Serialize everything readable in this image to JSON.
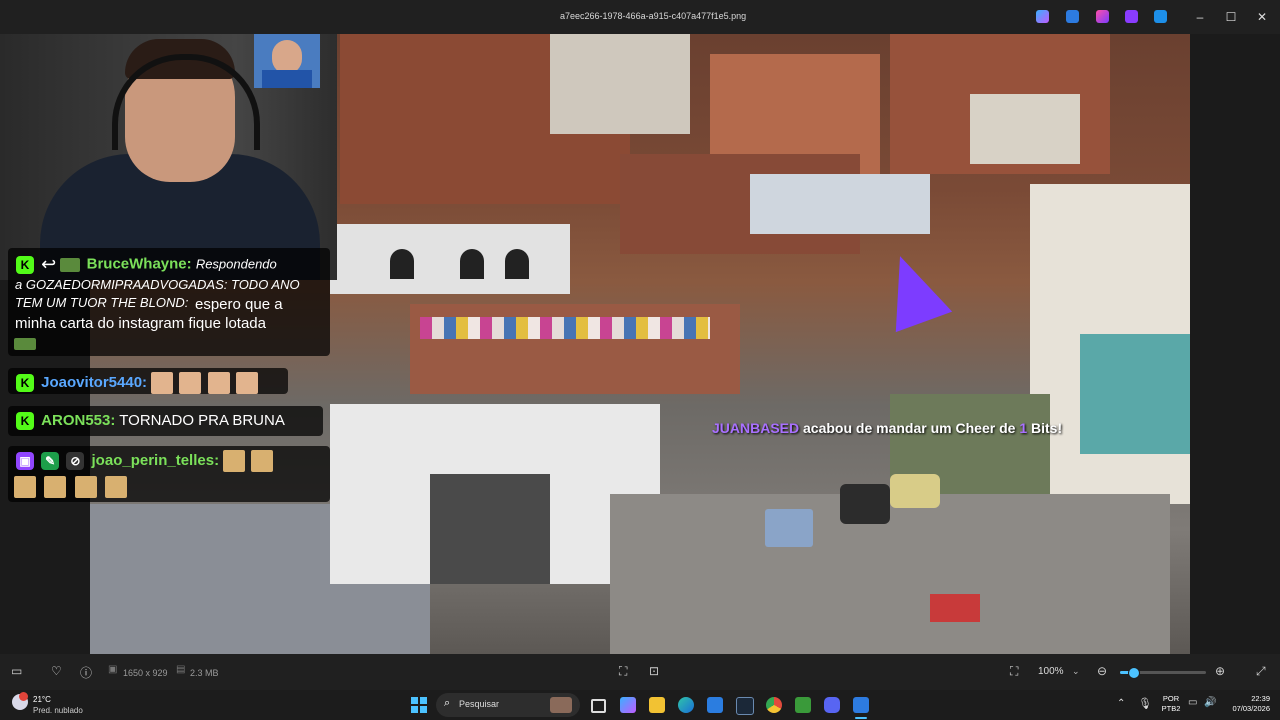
{
  "window": {
    "title": "a7eec266-1978-466a-a915-c407a477f1e5.png",
    "app_icons": [
      "copilot-icon",
      "paint-icon",
      "clipchamp-icon",
      "designer-icon",
      "onedrive-icon"
    ],
    "controls": {
      "minimize": "–",
      "maximize": "☐",
      "close": "✕"
    }
  },
  "chat": {
    "messages": [
      {
        "user": "BruceWhayne:",
        "reply_prefix": "Respondendo",
        "reply_body": "a GOZAEDORMIPRAADVOGADAS: TODO ANO TEM UM TUOR THE BLOND:",
        "text": "espero que a minha carta do instagram fique lotada",
        "user_color": "#7be05a"
      },
      {
        "user": "Joaovitor5440:",
        "text": "",
        "user_color": "#5aa8ff"
      },
      {
        "user": "ARON553:",
        "text": "TORNADO PRA BRUNA",
        "user_color": "#7be05a"
      },
      {
        "user": "joao_perin_telles:",
        "text": "",
        "user_color": "#7be05a"
      }
    ],
    "badges": {
      "kick": "K",
      "reply": "↩"
    }
  },
  "cheer": {
    "user": "JUANBASED",
    "text": "acabou de mandar um Cheer de",
    "amount": "1",
    "unit": "Bits!",
    "user_color": "#a970ff"
  },
  "toolbar": {
    "dimensions": "1650 x 929",
    "filesize": "2.3 MB",
    "zoom": "100%",
    "zoom_level": 0.15
  },
  "taskbar": {
    "weather_temp": "21°C",
    "weather_desc": "Pred. nublado",
    "search_placeholder": "Pesquisar",
    "language": "POR",
    "keyboard": "PTB2",
    "time": "22:39",
    "date": "07/03/2026"
  },
  "colors": {
    "accent": "#4cc2ff",
    "kick_green": "#53fc18",
    "twitch_purple": "#9146ff",
    "titlebar_bg": "#202020",
    "taskbar_bg": "#1c1c1c"
  }
}
